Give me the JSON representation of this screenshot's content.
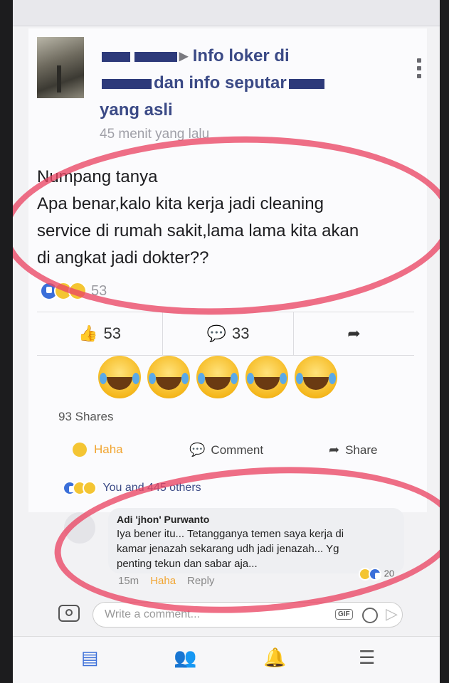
{
  "post": {
    "title_line1": "Info loker di",
    "title_line2": "dan info seputar",
    "title_line3": "yang asli",
    "time": "45 menit yang lalu",
    "text_line1": "Numpang tanya",
    "text_line2": "Apa benar,kalo kita kerja jadi cleaning",
    "text_line3": "service di rumah sakit,lama lama kita akan",
    "text_line4": "di angkat jadi dokter??",
    "reaction_count": "53",
    "likes": "53",
    "comments": "33",
    "shares": "93 Shares"
  },
  "actions": {
    "haha": "Haha",
    "comment": "Comment",
    "share": "Share"
  },
  "likes_line": "You and 445 others",
  "comment": {
    "author": "Adi 'jhon' Purwanto",
    "text_line1": "Iya bener itu... Tetangganya temen saya kerja di",
    "text_line2": "kamar jenazah sekarang udh jadi jenazah... Yg",
    "text_line3": "penting tekun dan sabar aja...",
    "time": "15m",
    "haha": "Haha",
    "reply": "Reply",
    "reaction_count": "20"
  },
  "composer": {
    "placeholder": "Write a comment...",
    "gif": "GIF"
  },
  "icons": [
    "thumbs-up-icon",
    "comment-icon",
    "share-icon",
    "camera-icon",
    "smile-icon",
    "send-icon",
    "news-feed-icon",
    "friends-icon",
    "bell-icon",
    "menu-icon",
    "kebab-icon"
  ],
  "colors": {
    "highlight": "#eb4664",
    "link": "#3b4a86",
    "haha": "#f1a531",
    "like": "#3b6fd9"
  }
}
